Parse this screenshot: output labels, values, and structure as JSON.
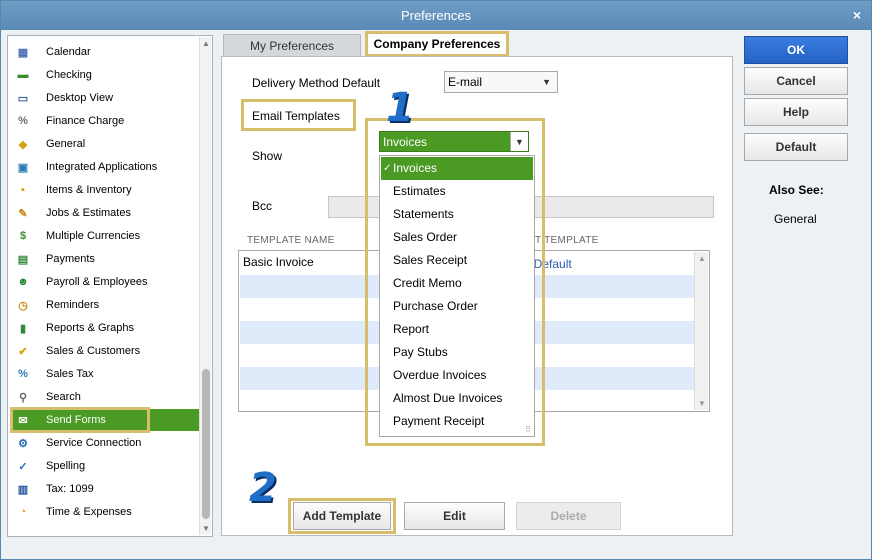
{
  "window": {
    "title": "Preferences",
    "close": "×"
  },
  "sidebar": {
    "items": [
      {
        "label": "Calendar",
        "icon": "calendar-icon"
      },
      {
        "label": "Checking",
        "icon": "checking-icon"
      },
      {
        "label": "Desktop View",
        "icon": "desktop-icon"
      },
      {
        "label": "Finance Charge",
        "icon": "percent-icon"
      },
      {
        "label": "General",
        "icon": "general-icon"
      },
      {
        "label": "Integrated Applications",
        "icon": "apps-icon"
      },
      {
        "label": "Items & Inventory",
        "icon": "boxes-icon"
      },
      {
        "label": "Jobs & Estimates",
        "icon": "jobs-icon"
      },
      {
        "label": "Multiple Currencies",
        "icon": "currency-icon"
      },
      {
        "label": "Payments",
        "icon": "payments-icon"
      },
      {
        "label": "Payroll & Employees",
        "icon": "payroll-icon"
      },
      {
        "label": "Reminders",
        "icon": "reminder-icon"
      },
      {
        "label": "Reports & Graphs",
        "icon": "chart-icon"
      },
      {
        "label": "Sales & Customers",
        "icon": "sales-icon"
      },
      {
        "label": "Sales Tax",
        "icon": "tax-icon"
      },
      {
        "label": "Search",
        "icon": "search-icon"
      },
      {
        "label": "Send Forms",
        "icon": "send-forms-icon",
        "active": true
      },
      {
        "label": "Service Connection",
        "icon": "service-icon"
      },
      {
        "label": "Spelling",
        "icon": "spelling-icon"
      },
      {
        "label": "Tax: 1099",
        "icon": "tax1099-icon"
      },
      {
        "label": "Time & Expenses",
        "icon": "clock-icon"
      }
    ]
  },
  "tabs": {
    "my": "My Preferences",
    "company": "Company Preferences"
  },
  "form": {
    "delivery_label": "Delivery Method Default",
    "delivery_value": "E-mail",
    "email_templates": "Email Templates",
    "show_label": "Show",
    "show_value": "Invoices",
    "bcc_label": "Bcc"
  },
  "table": {
    "col1": "TEMPLATE NAME",
    "col2": "T TEMPLATE",
    "rows": [
      {
        "name": "Basic Invoice",
        "default": "t Default"
      },
      {
        "name": "",
        "default": ""
      },
      {
        "name": "",
        "default": ""
      },
      {
        "name": "",
        "default": ""
      },
      {
        "name": "",
        "default": ""
      },
      {
        "name": "",
        "default": ""
      },
      {
        "name": "",
        "default": ""
      }
    ]
  },
  "dropdown": {
    "options": [
      "Invoices",
      "Estimates",
      "Statements",
      "Sales Order",
      "Sales Receipt",
      "Credit Memo",
      "Purchase Order",
      "Report",
      "Pay Stubs",
      "Overdue Invoices",
      "Almost Due Invoices",
      "Payment Receipt"
    ],
    "selected": "Invoices",
    "check": "✓"
  },
  "buttons": {
    "ok": "OK",
    "cancel": "Cancel",
    "help": "Help",
    "default": "Default",
    "add_template": "Add Template",
    "edit": "Edit",
    "delete": "Delete"
  },
  "also_see": {
    "label": "Also See:",
    "link": "General"
  },
  "steps": {
    "one": "1",
    "two": "2"
  },
  "colors": {
    "accent": "#4a9a23",
    "highlight": "#d6be6b",
    "title": "#5a8ab6",
    "primary": "#2563c4"
  }
}
